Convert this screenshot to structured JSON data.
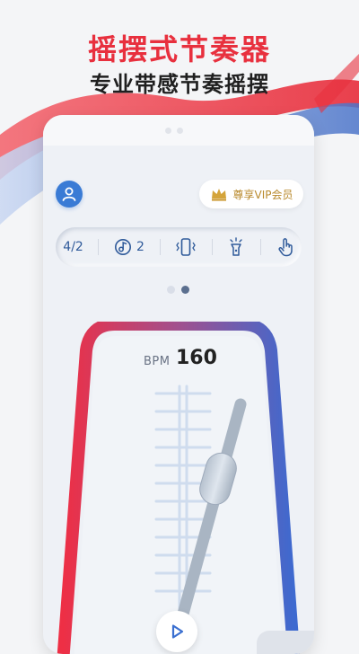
{
  "promo": {
    "title": "摇摆式节奏器",
    "subtitle": "专业带感节奏摇摆"
  },
  "header": {
    "avatar_icon": "user-icon",
    "vip_label": "尊享VIP会员",
    "vip_icon": "crown-icon"
  },
  "toolbar": {
    "time_signature": "4/2",
    "sound_count": "2",
    "items": [
      "time-signature",
      "sound-icon",
      "vibration-icon",
      "flashlight-icon",
      "tap-icon"
    ]
  },
  "pager": {
    "total": 2,
    "active": 2
  },
  "metronome": {
    "bpm_label": "BPM",
    "bpm_value": "160",
    "play_icon": "play-icon"
  },
  "colors": {
    "accent_red": "#e8303e",
    "accent_blue": "#3a6fd0",
    "vip_gold": "#b8892c",
    "icon_blue": "#2f5a9a"
  }
}
